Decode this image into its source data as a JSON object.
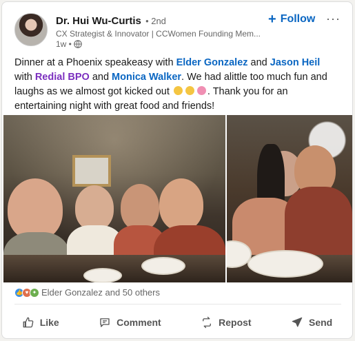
{
  "author": {
    "name": "Dr. Hui Wu-Curtis",
    "degree": "• 2nd",
    "headline": "CX Strategist & Innovator | CCWomen Founding Mem...",
    "time": "1w •"
  },
  "header": {
    "follow_label": "Follow",
    "more_label": "···"
  },
  "post": {
    "t1": "Dinner at a Phoenix speakeasy with ",
    "m1": "Elder Gonzalez",
    "t2": " and ",
    "m2": "Jason Heil",
    "t3": " with ",
    "m3": "Redial BPO",
    "t4": " and ",
    "m4": "Monica Walker",
    "t5": ". We had alittle too much fun and laughs as we almost got kicked out ",
    "t6": ". Thank you for an entertaining night with great food and friends!"
  },
  "reactions": {
    "summary": "Elder Gonzalez and 50 others",
    "icons": [
      "like-reaction-icon",
      "love-reaction-icon",
      "celebrate-reaction-icon"
    ]
  },
  "actions": {
    "like": "Like",
    "comment": "Comment",
    "repost": "Repost",
    "send": "Send"
  },
  "colors": {
    "link": "#0a66c2",
    "company_link": "#7b2fbf",
    "like_blue": "#378fe9",
    "love_red": "#df704d",
    "celebrate_green": "#6dae4f"
  }
}
